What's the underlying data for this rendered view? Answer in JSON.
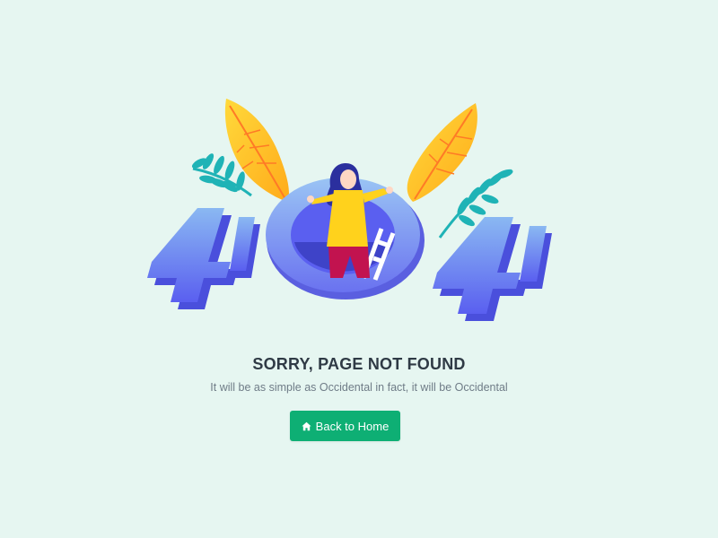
{
  "error": {
    "title": "SORRY, PAGE NOT FOUND",
    "message": "It will be as simple as Occidental in fact, it will be Occidental"
  },
  "button": {
    "label": "Back to Home",
    "icon": "home-icon"
  },
  "illustration": {
    "digits": [
      "4",
      "0",
      "4"
    ],
    "colors": {
      "digit": "#6f74f0",
      "leaf_yellow": "#ffc229",
      "leaf_teal": "#1fb3b6",
      "person_shirt": "#ffd21c",
      "person_pants": "#c2134f",
      "hair": "#2b2f9e"
    }
  },
  "colors": {
    "background": "#e6f6f1",
    "accent": "#0eaf74",
    "title": "#2f3a45",
    "subtitle": "#6f7c87"
  }
}
